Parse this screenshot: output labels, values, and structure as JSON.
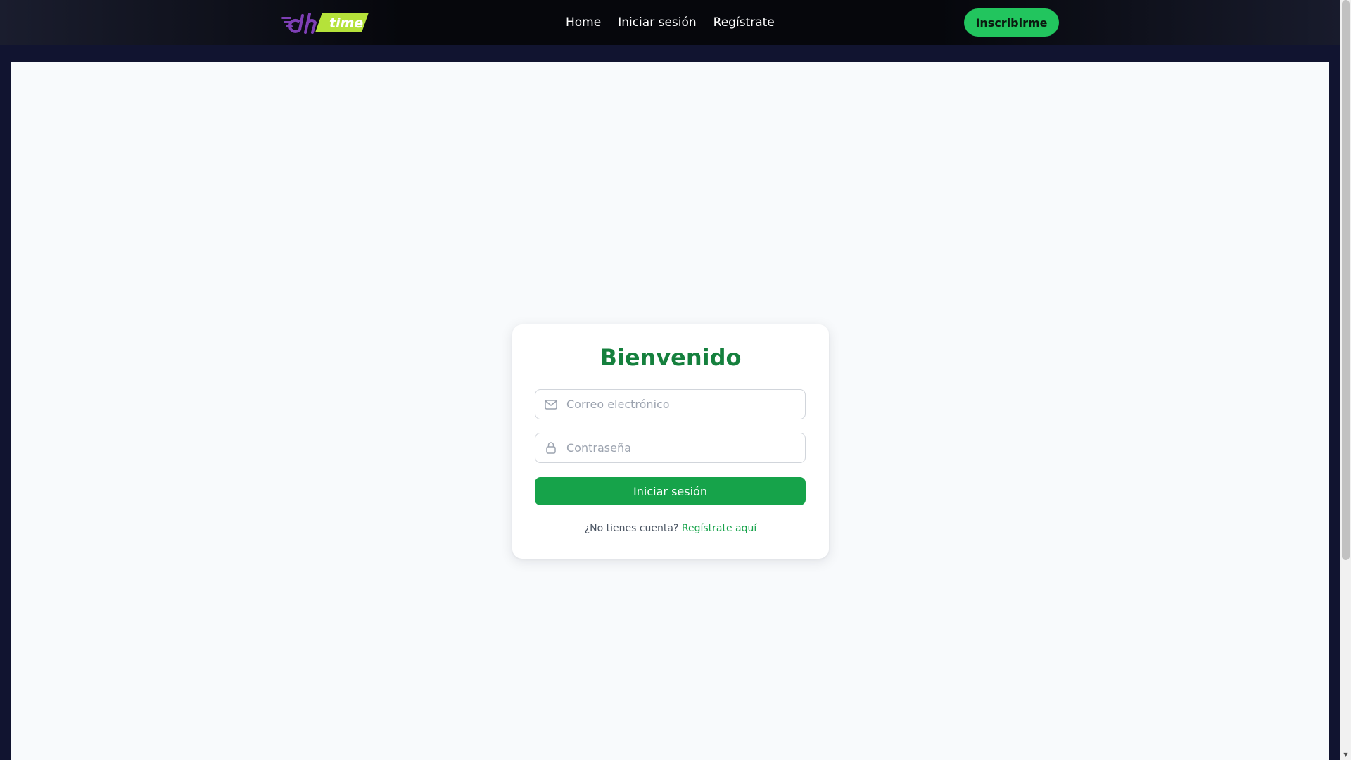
{
  "brand": {
    "logo_text": "time",
    "logo_icon": "dh-speed-logo-icon",
    "colors": {
      "purple": "#7e3fb5",
      "lime": "#b5e23a"
    }
  },
  "nav": {
    "links": [
      "Home",
      "Iniciar sesión",
      "Regístrate"
    ],
    "cta_label": "Inscribirme"
  },
  "login": {
    "title": "Bienvenido",
    "email_placeholder": "Correo electrónico",
    "email_icon": "mail-icon",
    "password_placeholder": "Contraseña",
    "password_icon": "lock-icon",
    "submit_label": "Iniciar sesión",
    "signup_prompt": "¿No tienes cuenta?",
    "signup_link": "Regístrate aquí"
  },
  "colors": {
    "accent": "#16a34a",
    "cta": "#22c55e",
    "title": "#15803d",
    "nav_bg": "#06070c",
    "page_bg": "#f8fafc"
  }
}
